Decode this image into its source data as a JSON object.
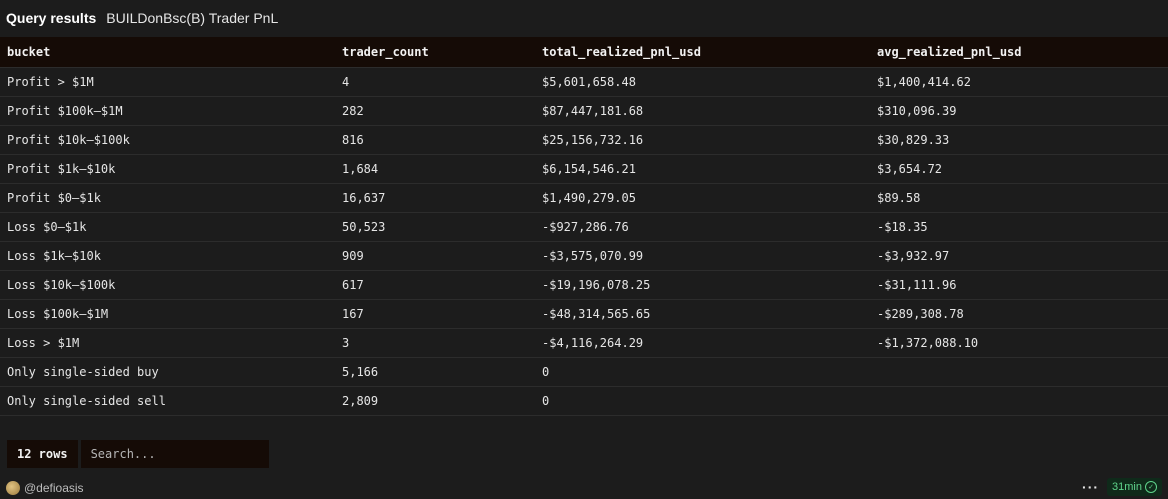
{
  "header": {
    "title": "Query results",
    "subtitle": "BUILDonBsc(B) Trader PnL"
  },
  "table": {
    "columns": [
      "bucket",
      "trader_count",
      "total_realized_pnl_usd",
      "avg_realized_pnl_usd"
    ],
    "rows": [
      [
        "Profit > $1M",
        "4",
        "$5,601,658.48",
        "$1,400,414.62"
      ],
      [
        "Profit $100k–$1M",
        "282",
        "$87,447,181.68",
        "$310,096.39"
      ],
      [
        "Profit $10k–$100k",
        "816",
        "$25,156,732.16",
        "$30,829.33"
      ],
      [
        "Profit $1k–$10k",
        "1,684",
        "$6,154,546.21",
        "$3,654.72"
      ],
      [
        "Profit $0–$1k",
        "16,637",
        "$1,490,279.05",
        "$89.58"
      ],
      [
        "Loss $0–$1k",
        "50,523",
        "-$927,286.76",
        "-$18.35"
      ],
      [
        "Loss $1k–$10k",
        "909",
        "-$3,575,070.99",
        "-$3,932.97"
      ],
      [
        "Loss $10k–$100k",
        "617",
        "-$19,196,078.25",
        "-$31,111.96"
      ],
      [
        "Loss $100k–$1M",
        "167",
        "-$48,314,565.65",
        "-$289,308.78"
      ],
      [
        "Loss > $1M",
        "3",
        "-$4,116,264.29",
        "-$1,372,088.10"
      ],
      [
        "Only single-sided buy",
        "5,166",
        "0",
        ""
      ],
      [
        "Only single-sided sell",
        "2,809",
        "0",
        ""
      ]
    ]
  },
  "footer": {
    "rows_label": "12 rows",
    "search_placeholder": "Search..."
  },
  "bottom": {
    "author": "@defioasis",
    "more_icon": "more-horizontal-icon",
    "more_glyph": "···",
    "freshness": "31min",
    "freshness_icon": "check-circle-icon",
    "freshness_color": "#5fd38b"
  }
}
